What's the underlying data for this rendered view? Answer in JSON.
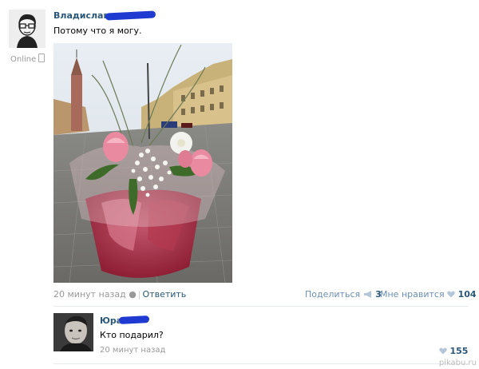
{
  "post": {
    "author": "Владислав",
    "status": "Online",
    "text": "Потому что я могу.",
    "time": "20 минут назад",
    "reply_label": "Ответить",
    "share_label": "Поделиться",
    "share_count": "3",
    "like_label": "Мне нравится",
    "like_count": "104"
  },
  "comment": {
    "author": "Юра",
    "text": "Кто подарил?",
    "time": "20 минут назад",
    "like_count": "155"
  },
  "watermark": "pikabu.ru",
  "colors": {
    "link": "#2b587a",
    "muted": "#999999",
    "action": "#6d8fb3",
    "scribble": "#1f3ad0"
  }
}
